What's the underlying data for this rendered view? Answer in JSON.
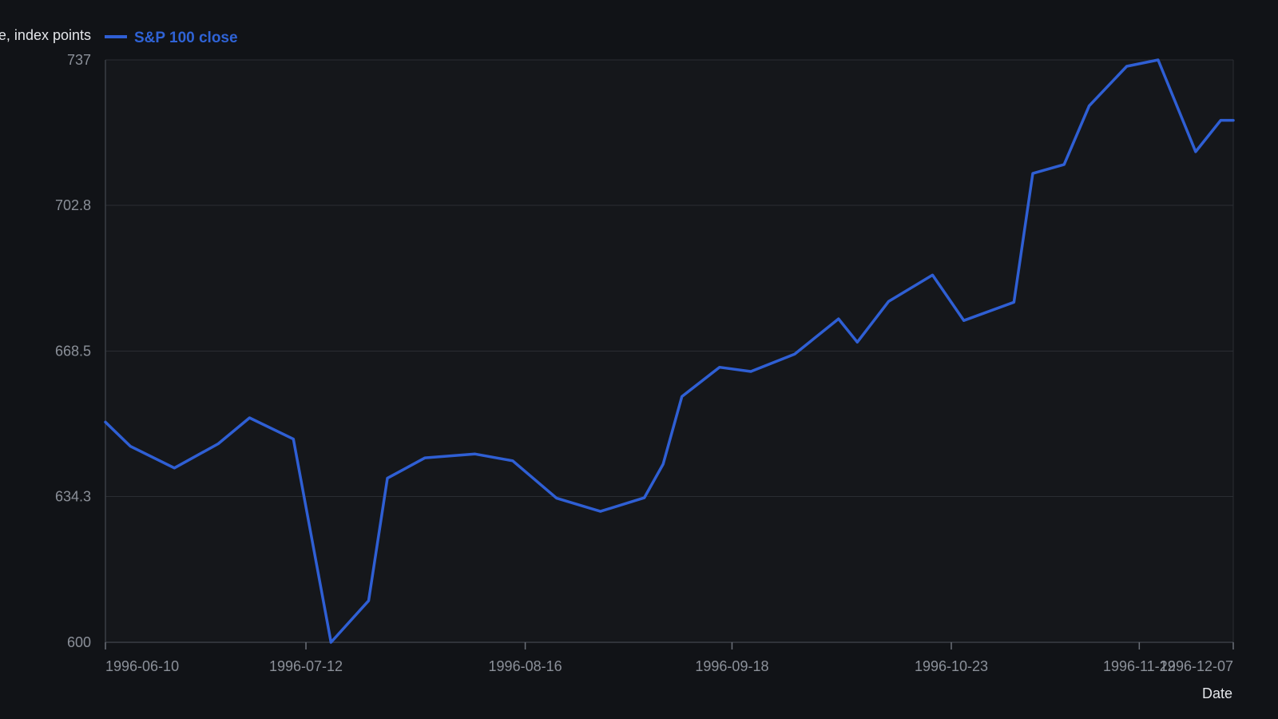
{
  "colors": {
    "background": "#111317",
    "plot_background": "#15171b",
    "grid": "#2a2d33",
    "axis": "#3a3e45",
    "series": "#2f5fd4",
    "tick_text": "#8b9099",
    "title_text": "#e4e6ea"
  },
  "chart_data": {
    "type": "line",
    "ylabel": "Close, index points",
    "xlabel": "Date",
    "ylim": [
      600,
      737
    ],
    "yticks": [
      "600",
      "634.3",
      "668.5",
      "702.8",
      "737"
    ],
    "xticks": [
      "1996-06-10",
      "1996-07-12",
      "1996-08-16",
      "1996-09-18",
      "1996-10-23",
      "1996-11-22",
      "1996-12-07"
    ],
    "grid": true,
    "legend": "top-left",
    "series": [
      {
        "name": "S&P 100 close",
        "x": [
          "1996-06-10",
          "1996-06-14",
          "1996-06-21",
          "1996-06-28",
          "1996-07-03",
          "1996-07-10",
          "1996-07-16",
          "1996-07-22",
          "1996-07-25",
          "1996-07-31",
          "1996-08-08",
          "1996-08-14",
          "1996-08-21",
          "1996-08-28",
          "1996-09-04",
          "1996-09-07",
          "1996-09-10",
          "1996-09-16",
          "1996-09-21",
          "1996-09-28",
          "1996-10-05",
          "1996-10-08",
          "1996-10-13",
          "1996-10-20",
          "1996-10-25",
          "1996-11-02",
          "1996-11-05",
          "1996-11-10",
          "1996-11-14",
          "1996-11-20",
          "1996-11-25",
          "1996-12-01",
          "1996-12-05",
          "1996-12-07"
        ],
        "values": [
          651.8,
          646.1,
          641.0,
          646.7,
          652.8,
          647.8,
          600.0,
          609.8,
          638.6,
          643.4,
          644.3,
          642.7,
          633.9,
          630.8,
          634.0,
          641.9,
          657.8,
          664.7,
          663.7,
          667.8,
          676.1,
          670.6,
          680.2,
          686.4,
          675.7,
          680.0,
          710.3,
          712.4,
          726.2,
          735.5,
          737.0,
          715.4,
          722.8,
          722.8
        ]
      }
    ]
  }
}
